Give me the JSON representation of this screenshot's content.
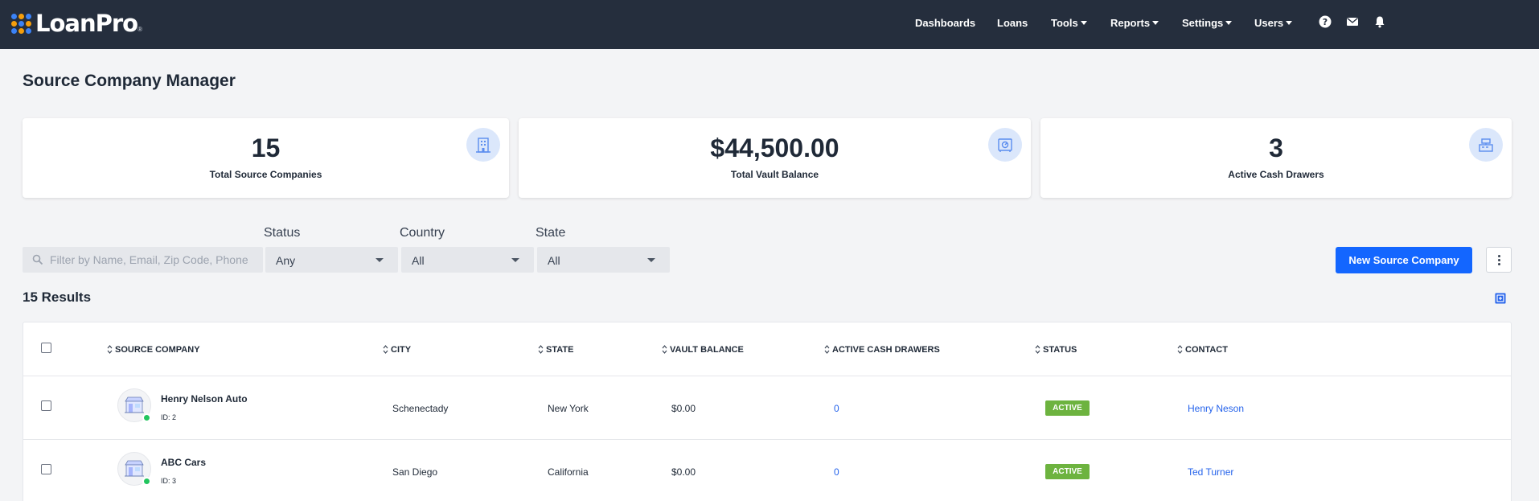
{
  "app": {
    "brand": "LoanPro",
    "brand_mark": "®",
    "colors": {
      "nav_bg": "#252e3d",
      "primary": "#1366ff",
      "active": "#6db33f",
      "link": "#2563eb",
      "logo_dots": [
        "#3b82f6",
        "#f59e0b",
        "#3b82f6",
        "#f59e0b",
        "#3b82f6",
        "#f59e0b",
        "#3b82f6",
        "#f59e0b",
        "#3b82f6"
      ]
    }
  },
  "nav": {
    "dashboards": "Dashboards",
    "loans": "Loans",
    "tools": "Tools",
    "reports": "Reports",
    "settings": "Settings",
    "users": "Users",
    "icons": [
      "help-icon",
      "mail-icon",
      "bell-icon"
    ]
  },
  "page": {
    "title": "Source Company Manager"
  },
  "stats": [
    {
      "value": "15",
      "label": "Total Source Companies",
      "icon": "building-icon"
    },
    {
      "value": "$44,500.00",
      "label": "Total Vault Balance",
      "icon": "vault-icon"
    },
    {
      "value": "3",
      "label": "Active Cash Drawers",
      "icon": "cash-register-icon"
    }
  ],
  "filters": {
    "search_placeholder": "Filter by Name, Email, Zip Code, Phone",
    "status": {
      "label": "Status",
      "value": "Any"
    },
    "country": {
      "label": "Country",
      "value": "All"
    },
    "state": {
      "label": "State",
      "value": "All"
    }
  },
  "actions": {
    "new_label": "New Source Company"
  },
  "results": {
    "label": "15 Results"
  },
  "table": {
    "columns": [
      "SOURCE COMPANY",
      "CITY",
      "STATE",
      "VAULT BALANCE",
      "ACTIVE CASH DRAWERS",
      "STATUS",
      "CONTACT"
    ],
    "rows": [
      {
        "name": "Henry Nelson Auto",
        "id": "ID: 2",
        "city": "Schenectady",
        "state": "New York",
        "vault": "$0.00",
        "drawers": "0",
        "status": "ACTIVE",
        "contact": "Henry Neson"
      },
      {
        "name": "ABC Cars",
        "id": "ID: 3",
        "city": "San Diego",
        "state": "California",
        "vault": "$0.00",
        "drawers": "0",
        "status": "ACTIVE",
        "contact": "Ted Turner"
      }
    ]
  }
}
